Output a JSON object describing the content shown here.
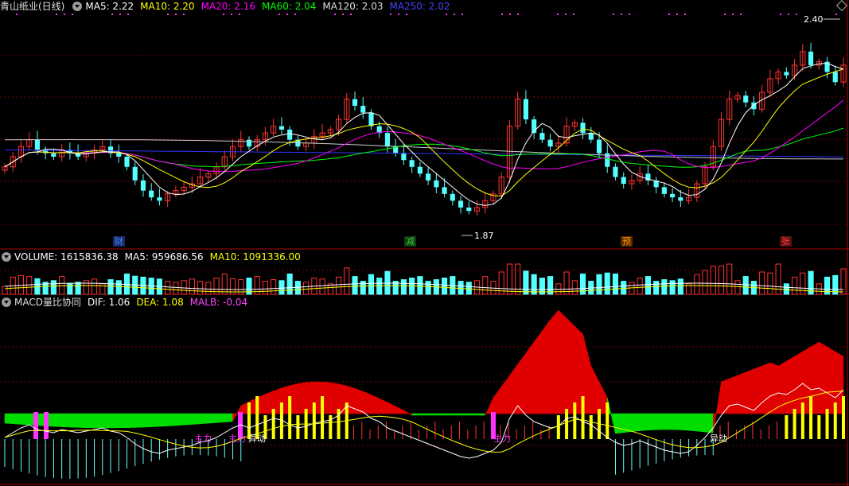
{
  "main_header": {
    "stock_name": "青山纸业(日线)",
    "ma5": "MA5: 2.22",
    "ma10": "MA10: 2.20",
    "ma20": "MA20: 2.16",
    "ma60": "MA60: 2.04",
    "ma120": "MA120: 2.03",
    "ma250": "MA250: 2.02"
  },
  "volume_header": {
    "volume": "VOLUME: 1615836.38",
    "ma5": "MA5: 959686.56",
    "ma10": "MA10: 1091336.00"
  },
  "macd_header": {
    "name": "MACD量比协同",
    "dif": "DIF: 1.06",
    "dea": "DEA: 1.08",
    "malb": "MALB: -0.04"
  },
  "price_labels": {
    "high": "2.40",
    "low": "1.87"
  },
  "markers": [
    {
      "text": "财",
      "color": "#3a8cff"
    },
    {
      "text": "减",
      "color": "#33cc33"
    },
    {
      "text": "预",
      "color": "#ff9900"
    },
    {
      "text": "张",
      "color": "#ff4444"
    }
  ],
  "macd_labels": [
    "主力",
    "主力",
    "异动",
    "主力",
    "异动"
  ],
  "colors": {
    "up": "#ff3333",
    "down": "#54ffff",
    "ma5": "#ffffff",
    "ma10": "#ffff00",
    "ma20": "#ff00ff",
    "ma60": "#00ff00",
    "ma120": "#cccccc",
    "ma250": "#3333ff",
    "grid": "#7a0000",
    "red_area": "#e00000",
    "green_area": "#00dd00"
  },
  "chart_data": {
    "type": "candlestick",
    "ylim": [
      1.8,
      2.45
    ],
    "price_close": [
      2.0,
      2.03,
      2.06,
      2.08,
      2.05,
      2.04,
      2.03,
      2.05,
      2.04,
      2.03,
      2.04,
      2.05,
      2.06,
      2.04,
      2.03,
      2.0,
      1.96,
      1.93,
      1.91,
      1.9,
      1.92,
      1.93,
      1.94,
      1.95,
      1.97,
      1.98,
      2.0,
      2.03,
      2.06,
      2.08,
      2.06,
      2.08,
      2.1,
      2.12,
      2.11,
      2.08,
      2.06,
      2.07,
      2.09,
      2.1,
      2.11,
      2.14,
      2.2,
      2.18,
      2.16,
      2.12,
      2.1,
      2.06,
      2.04,
      2.02,
      2.0,
      1.98,
      1.96,
      1.94,
      1.92,
      1.9,
      1.88,
      1.87,
      1.88,
      1.9,
      1.92,
      1.97,
      2.12,
      2.2,
      2.14,
      2.1,
      2.08,
      2.06,
      2.07,
      2.12,
      2.13,
      2.1,
      2.08,
      2.04,
      2.0,
      1.97,
      1.95,
      1.96,
      1.98,
      1.96,
      1.94,
      1.92,
      1.91,
      1.9,
      1.91,
      1.95,
      2.0,
      2.06,
      2.14,
      2.2,
      2.21,
      2.19,
      2.17,
      2.22,
      2.26,
      2.28,
      2.27,
      2.3,
      2.34,
      2.3,
      2.31,
      2.28,
      2.25,
      2.3
    ]
  }
}
